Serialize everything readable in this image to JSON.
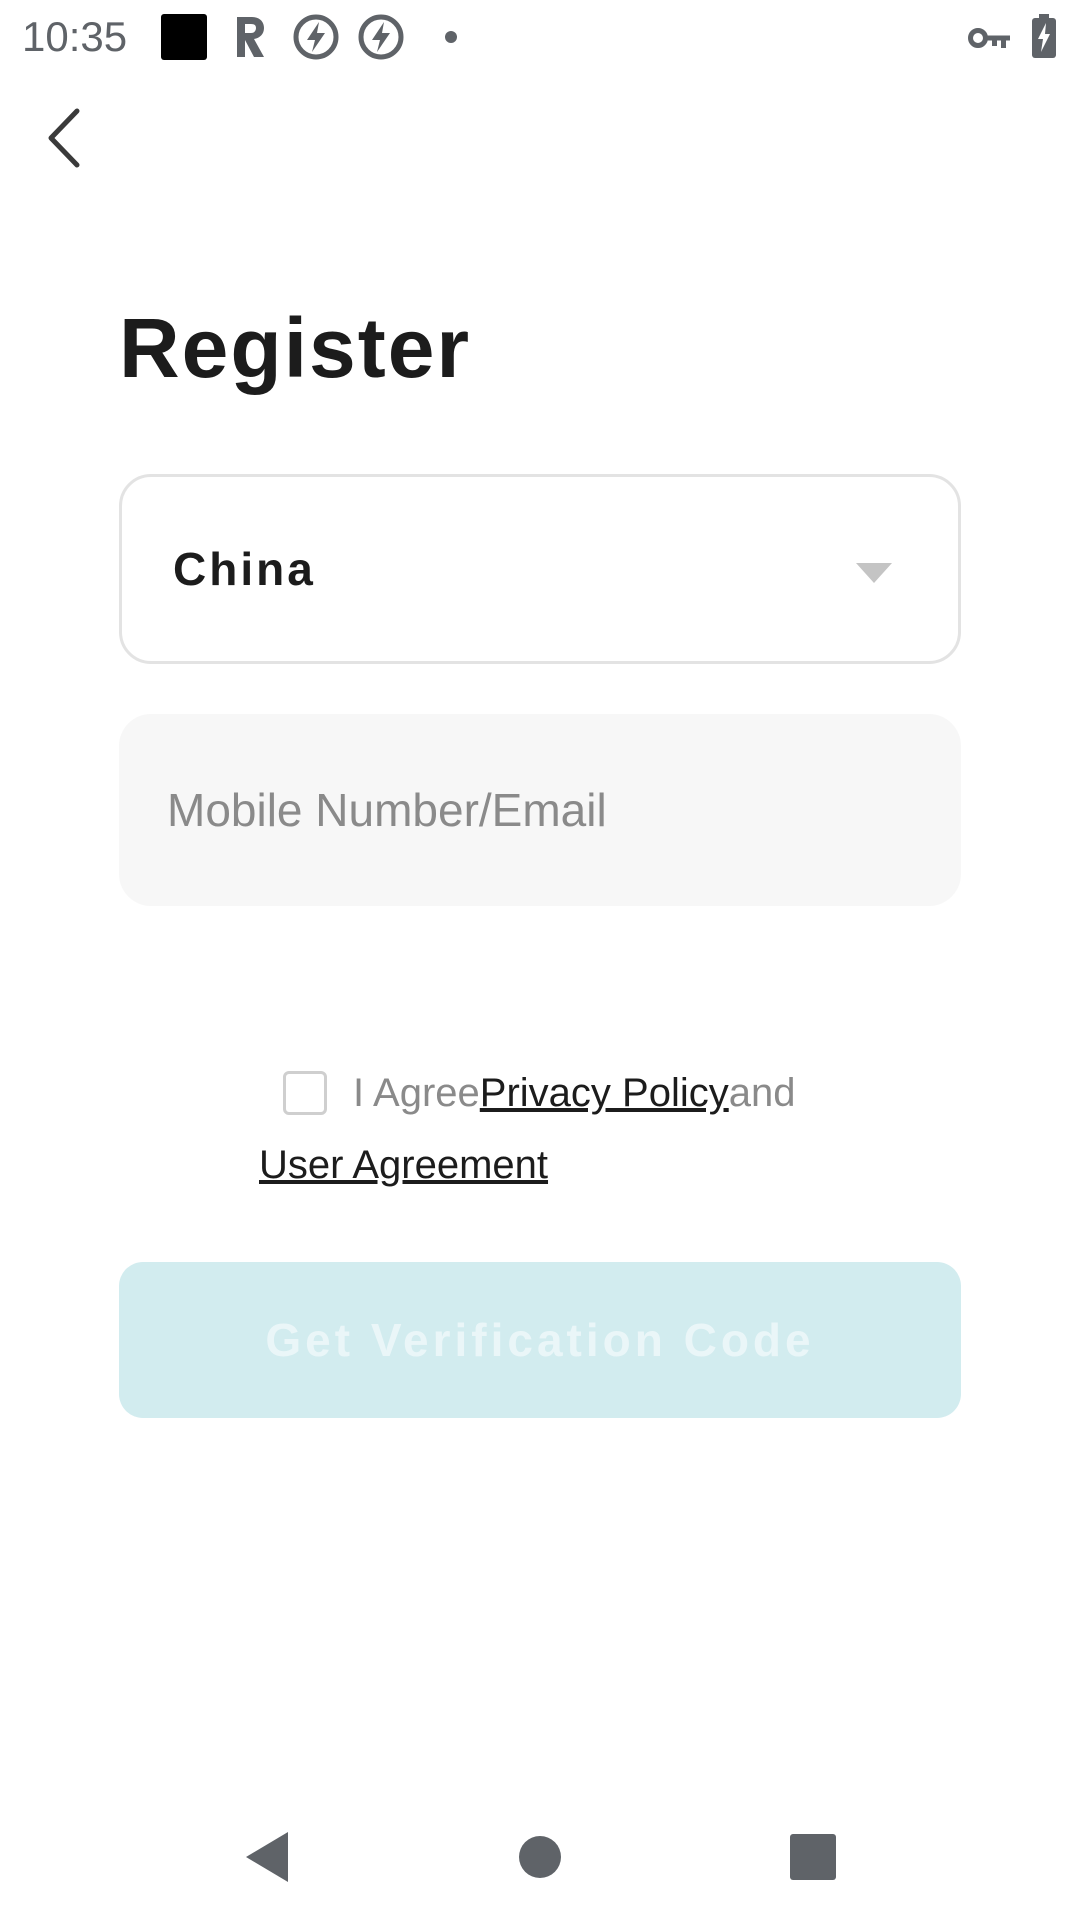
{
  "status_bar": {
    "time": "10:35",
    "left_icons": [
      "black-square-icon",
      "r-icon",
      "flash-circle-icon",
      "flash-circle-icon",
      "dot-icon"
    ],
    "right_icons": [
      "vpn-key-icon",
      "battery-charging-icon"
    ]
  },
  "header": {
    "back_icon": "chevron-left-icon"
  },
  "page": {
    "title": "Register"
  },
  "form": {
    "country": "China",
    "country_dropdown_icon": "triangle-down-icon",
    "contact_placeholder": "Mobile Number/Email",
    "contact_value": ""
  },
  "agreement": {
    "checked": false,
    "prefix": "I Agree",
    "privacy_link": "Privacy Policy",
    "conjunction": "and",
    "user_agreement_link": "User Agreement"
  },
  "actions": {
    "get_code_label": "Get Verification Code",
    "enabled": false
  },
  "colors": {
    "button_disabled_bg": "#d2ecef",
    "button_disabled_text": "#eaf6f8",
    "input_bg": "#f7f7f7",
    "title": "#1c1c1c"
  },
  "nav_bar": {
    "icons": [
      "back-triangle-icon",
      "home-circle-icon",
      "recents-square-icon"
    ]
  }
}
